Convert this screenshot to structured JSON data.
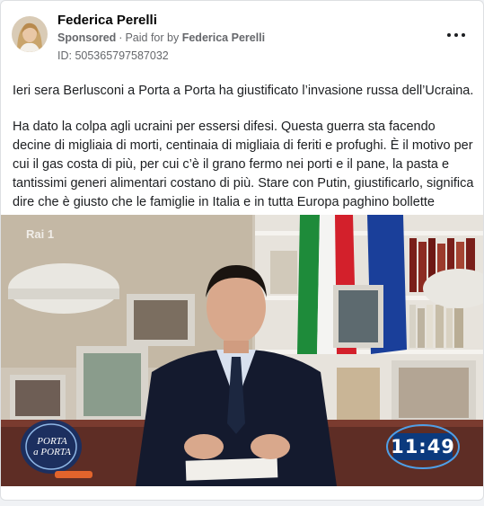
{
  "post": {
    "author": "Federica Perelli",
    "sponsored_label": "Sponsored",
    "paid_for_prefix": "Paid for by",
    "paid_for_name": "Federica Perelli",
    "ad_id": "ID: 505365797587032",
    "more_icon": "more-horizontal-icon",
    "paragraphs": [
      "Ieri sera Berlusconi a Porta a Porta ha giustificato l’invasione russa dell’Ucraina.",
      "Ha dato la colpa agli ucraini per essersi difesi. Questa guerra sta facendo decine di migliaia di morti, centinaia di migliaia di feriti e profughi. È il motivo per cui il gas costa di più, per cui c’è il grano fermo nei porti e il pane, la pasta e tantissimi generi alimentari costano di più. Stare con Putin, giustificarlo, significa dire che è giusto che le famiglie in Italia e in tutta Europa paghino bollette altissime..."
    ]
  },
  "video": {
    "channel_logo": "Rai 1",
    "show_logo_line1": "PORTA",
    "show_logo_line2": "a PORTA",
    "clock": "11:49"
  },
  "colors": {
    "name": "#050505",
    "meta": "#65676b",
    "text": "#1c1e21",
    "clock_bg": "#0b3a7e"
  }
}
